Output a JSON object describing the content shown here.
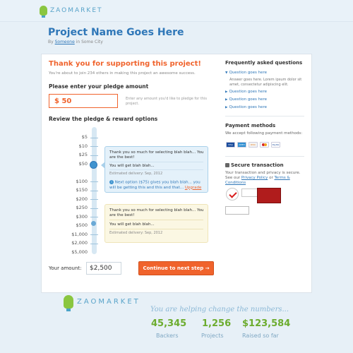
{
  "header": {
    "logo_text": "ZAOMARKET",
    "logo_icon": "lightbulb-icon"
  },
  "project": {
    "title": "Project Name Goes Here",
    "byline_prefix": "By",
    "author": "Someone",
    "byline_suffix": "in Some City"
  },
  "main": {
    "thanks_title": "Thank you for supporting this project!",
    "thanks_sub": "You're about to join 234 others in making this project an awesome success.",
    "pledge_label": "Please enter your pledge amount",
    "pledge_value": "$ 50",
    "pledge_hint": "Enter any amount you'd like to pledge for this project.",
    "review_label": "Review the pledge & reward options",
    "amounts": [
      "$5",
      "$10",
      "$25",
      "$50",
      "$100",
      "$150",
      "$200",
      "$250",
      "$300",
      "$500",
      "$1,000",
      "$2,000",
      "$5,000"
    ],
    "reward1": {
      "title": "Thank you so much for selecting blah blah... You are the best!",
      "line": "You will get blah blah...",
      "delivery": "Estimated delivery: Sep, 2012",
      "next_option": "Next option ($75) gives you blah blah... you will be getting this and this and that...",
      "upgrade": "Upgrade"
    },
    "reward2": {
      "title": "Thank you so much for selecting blah blah... You are the best!",
      "line": "You will get blah blah...",
      "delivery": "Estimated delivery: Sep, 2012"
    },
    "your_amount_label": "Your amount:",
    "your_amount_value": "$2,500",
    "continue_label": "Continue to next step →"
  },
  "sidebar": {
    "faq_title": "Frequently asked questions",
    "faq_items": [
      "Question goes here",
      "Question goes here",
      "Question goes here",
      "Question goes here"
    ],
    "faq_answer": "Answer goes here. Lorem ipsum dolor sit amet, consectetur adipiscing elit.",
    "payment_title": "Payment methods",
    "payment_text": "We accept following payment methods:",
    "payment_icons": [
      "visa-icon",
      "amex-icon",
      "discover-icon",
      "mastercard-icon",
      "paypal-icon"
    ],
    "secure_title": "Secure transaction",
    "secure_text": "Your transaction and privacy is secure. See our",
    "privacy_link": "Privacy Policy",
    "secure_and": "or",
    "terms_link": "Terms & Conditions",
    "seal_badges": [
      "verisign-icon",
      "security-scanned-icon",
      "sitelock-icon"
    ]
  },
  "footer": {
    "logo_text": "ZAOMARKET",
    "helping_text": "You are helping change the numbers...",
    "stats": [
      {
        "value": "45,345",
        "label": "Backers"
      },
      {
        "value": "1,256",
        "label": "Projects"
      },
      {
        "value": "$123,584",
        "label": "Raised so far"
      }
    ]
  },
  "colors": {
    "accent": "#f0632c",
    "brand_blue": "#2f77b8",
    "green": "#6cac2e"
  }
}
